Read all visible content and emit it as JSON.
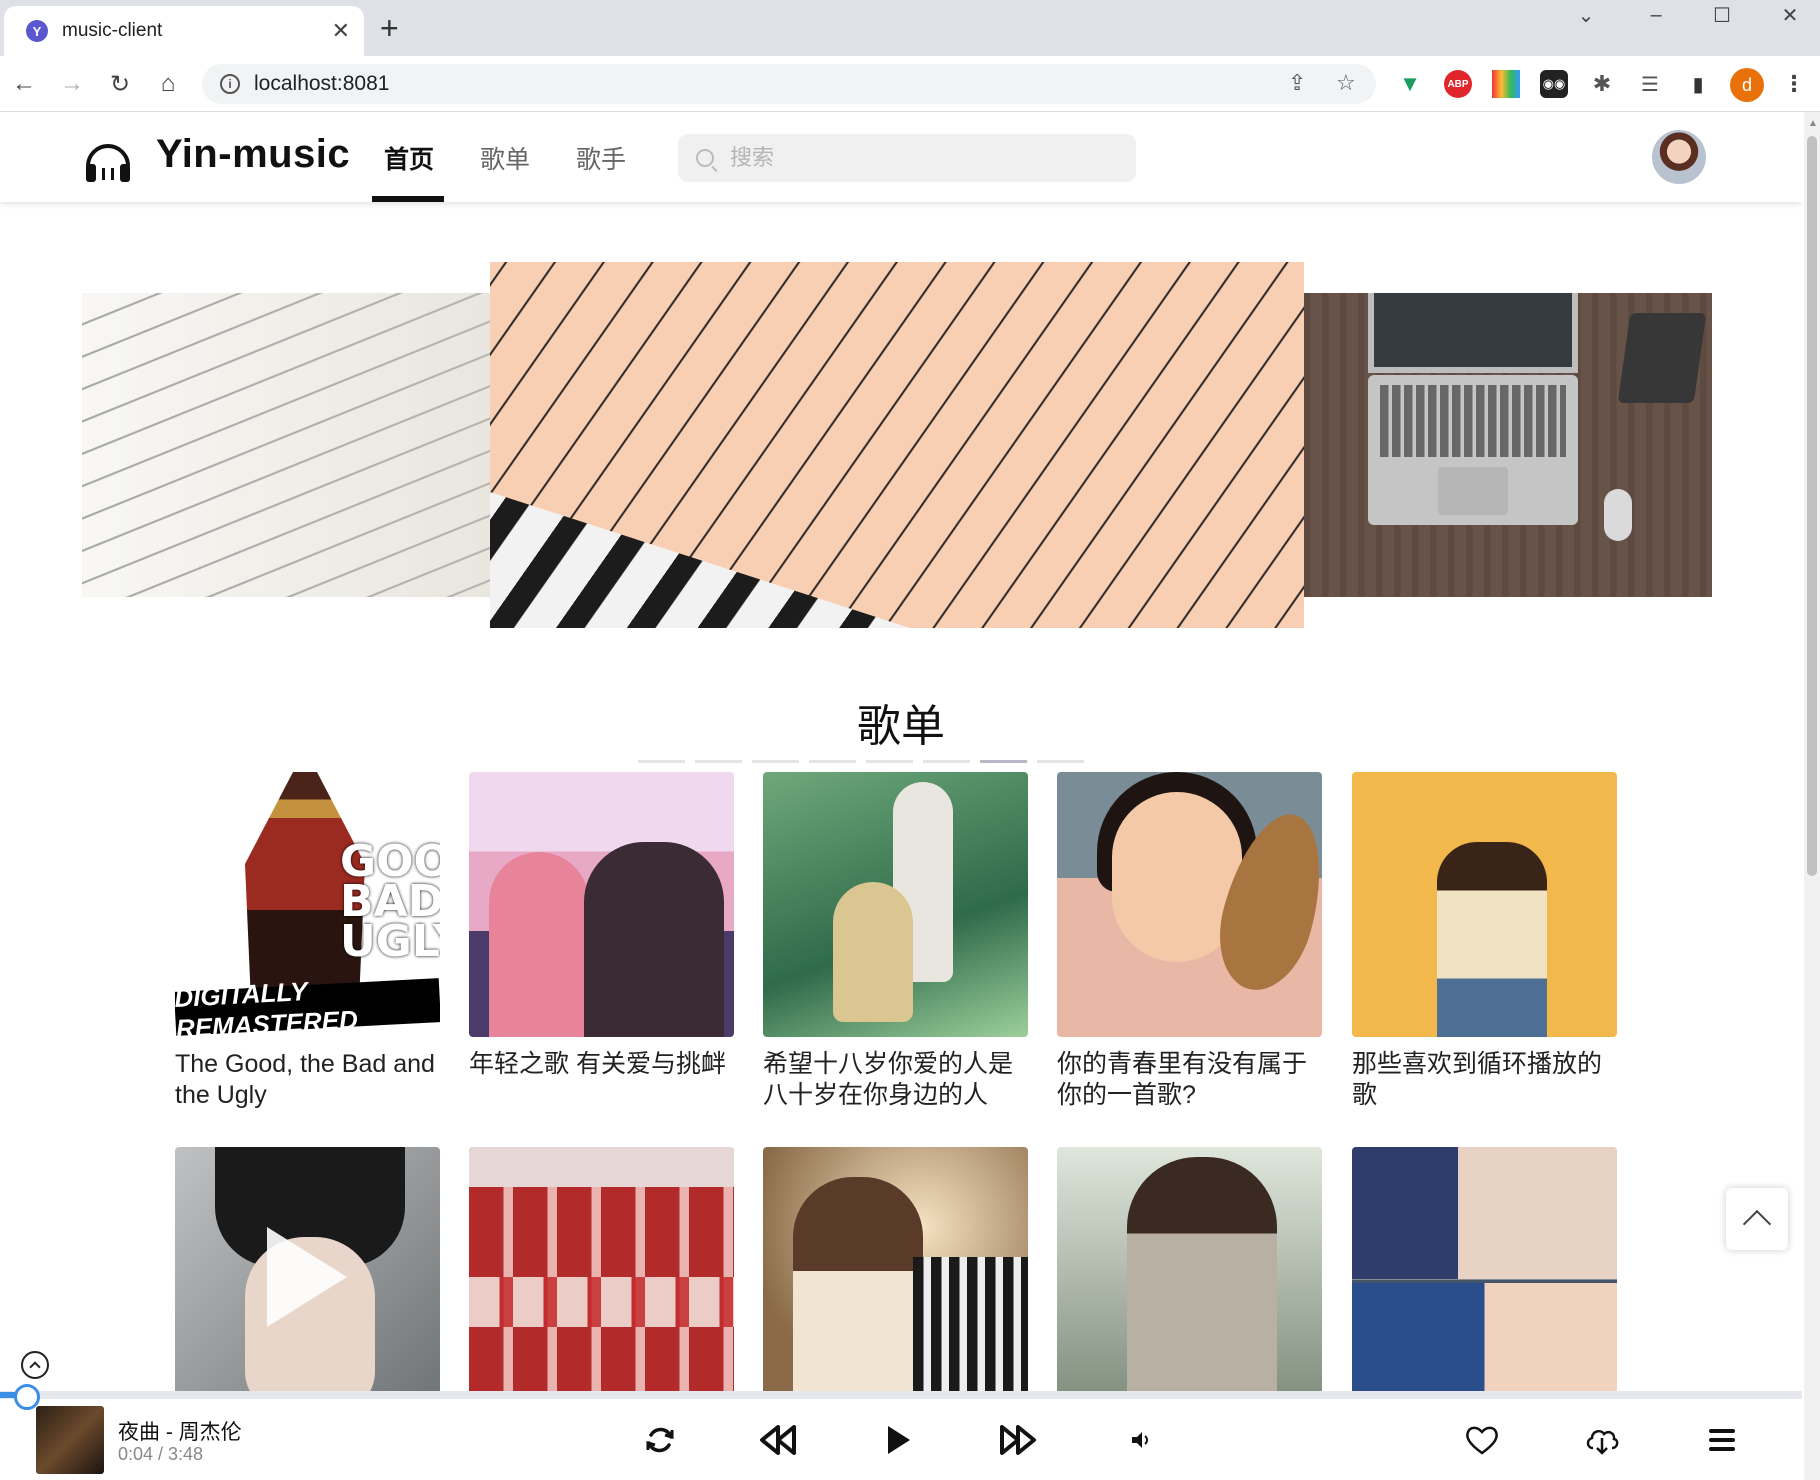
{
  "browser": {
    "tab_title": "music-client",
    "tab_favicon": "Y",
    "url": "localhost:8081",
    "profile_initial": "d",
    "extensions": [
      "vue-devtools-icon",
      "adblock-icon",
      "color-grid-icon",
      "glasses-icon",
      "puzzle-icon",
      "reading-list-icon",
      "side-panel-icon"
    ],
    "adblock_label": "ABP"
  },
  "header": {
    "logo_text": "Yin-music",
    "nav": [
      "首页",
      "歌单",
      "歌手"
    ],
    "active_nav": "首页",
    "search_placeholder": "搜索"
  },
  "carousel": {
    "dots_count": 8,
    "active_dot": 7
  },
  "section": {
    "title": "歌单"
  },
  "playlists": [
    {
      "name": "The Good, the Bad and the Ugly",
      "cover_text": "GOOD BAD UGLY",
      "cover_banner": "DIGITALLY REMASTERED"
    },
    {
      "name": "年轻之歌 有关爱与挑衅"
    },
    {
      "name": "希望十八岁你爱的人是八十岁在你身边的人"
    },
    {
      "name": "你的青春里有没有属于你的一首歌?"
    },
    {
      "name": "那些喜欢到循环播放的歌"
    },
    {
      "name": ""
    },
    {
      "name": ""
    },
    {
      "name": ""
    },
    {
      "name": ""
    },
    {
      "name": ""
    }
  ],
  "player": {
    "song_title": "夜曲 - 周杰伦",
    "current_time": "0:04",
    "duration": "3:48",
    "time_display": "0:04 / 3:48",
    "progress_fraction": 0.017,
    "accent": "#3a8ee6"
  }
}
